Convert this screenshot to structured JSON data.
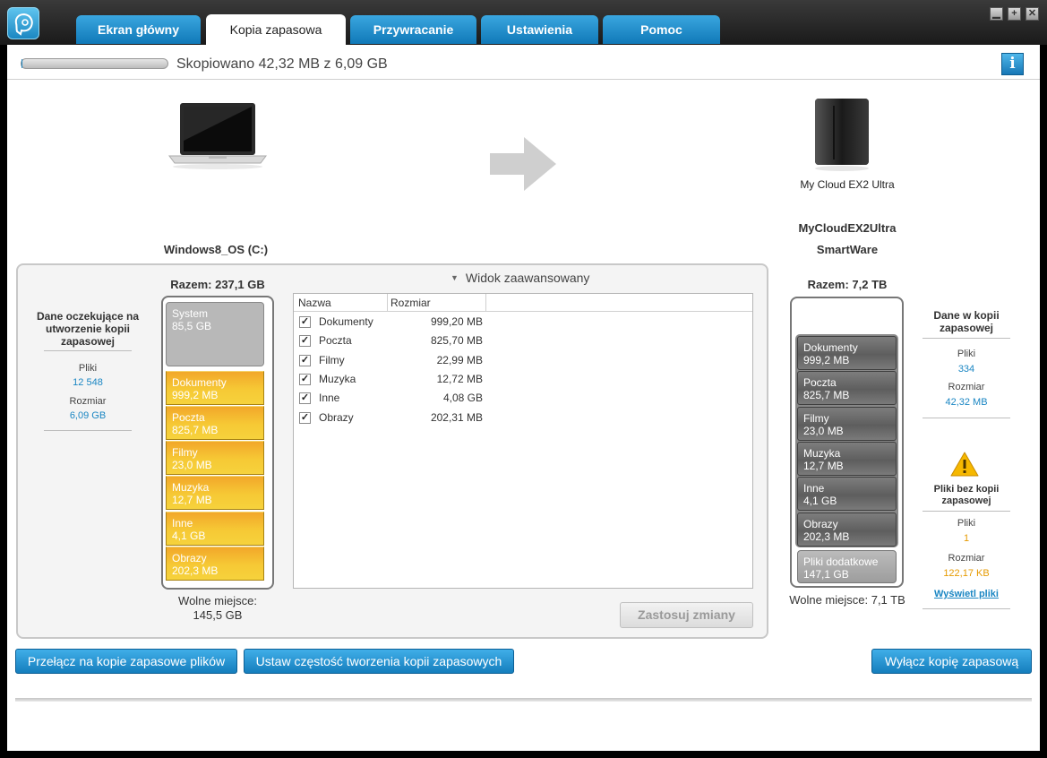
{
  "tabs": [
    {
      "label": "Ekran główny"
    },
    {
      "label": "Kopia zapasowa"
    },
    {
      "label": "Przywracanie"
    },
    {
      "label": "Ustawienia"
    },
    {
      "label": "Pomoc"
    }
  ],
  "window_controls": {
    "minimize": "▁",
    "maximize": "+",
    "close": "✕"
  },
  "progress": {
    "fraction": 0.007,
    "status_text": "Skopiowano 42,32 MB z 6,09 GB"
  },
  "info_button": "i",
  "source": {
    "drive_name": "Windows8_OS (C:)",
    "total": "Razem: 237,1 GB",
    "free": "Wolne miejsce: 145,5 GB",
    "system": {
      "name": "System",
      "size": "85,5 GB"
    },
    "segments": [
      {
        "name": "Dokumenty",
        "size": "999,2 MB"
      },
      {
        "name": "Poczta",
        "size": "825,7 MB"
      },
      {
        "name": "Filmy",
        "size": "23,0 MB"
      },
      {
        "name": "Muzyka",
        "size": "12,7 MB"
      },
      {
        "name": "Inne",
        "size": "4,1 GB"
      },
      {
        "name": "Obrazy",
        "size": "202,3 MB"
      }
    ]
  },
  "pending": {
    "title": "Dane oczekujące na utworzenie kopii zapasowej",
    "files_label": "Pliki",
    "files_value": "12 548",
    "size_label": "Rozmiar",
    "size_value": "6,09 GB"
  },
  "advanced_view": {
    "toggle_label": "Widok zaawansowany",
    "columns": [
      "Nazwa",
      "Rozmiar"
    ],
    "rows": [
      {
        "name": "Dokumenty",
        "size": "999,20 MB",
        "checked": true
      },
      {
        "name": "Poczta",
        "size": "825,70 MB",
        "checked": true
      },
      {
        "name": "Filmy",
        "size": "22,99 MB",
        "checked": true
      },
      {
        "name": "Muzyka",
        "size": "12,72 MB",
        "checked": true
      },
      {
        "name": "Inne",
        "size": "4,08 GB",
        "checked": true
      },
      {
        "name": "Obrazy",
        "size": "202,31 MB",
        "checked": true
      }
    ],
    "apply_button": "Zastosuj zmiany"
  },
  "destination": {
    "device_label": "My Cloud EX2 Ultra",
    "share_name": "MyCloudEX2Ultra",
    "folder_name": "SmartWare",
    "total": "Razem: 7,2 TB",
    "free": "Wolne miejsce: 7,1 TB",
    "segments": [
      {
        "name": "Dokumenty",
        "size": "999,2 MB"
      },
      {
        "name": "Poczta",
        "size": "825,7 MB"
      },
      {
        "name": "Filmy",
        "size": "23,0 MB"
      },
      {
        "name": "Muzyka",
        "size": "12,7 MB"
      },
      {
        "name": "Inne",
        "size": "4,1 GB"
      },
      {
        "name": "Obrazy",
        "size": "202,3 MB"
      }
    ],
    "extra": {
      "name": "Pliki dodatkowe",
      "size": "147,1 GB"
    }
  },
  "backed_up": {
    "title": "Dane w kopii zapasowej",
    "files_label": "Pliki",
    "files_value": "334",
    "size_label": "Rozmiar",
    "size_value": "42,32 MB"
  },
  "not_backed": {
    "title": "Pliki bez kopii zapasowej",
    "files_label": "Pliki",
    "files_value": "1",
    "size_label": "Rozmiar",
    "size_value": "122,17 KB",
    "link": "Wyświetl pliki"
  },
  "bottom_buttons": {
    "switch_files": "Przełącz na kopie zapasowe plików",
    "set_frequency": "Ustaw częstość tworzenia kopii zapasowych",
    "disable_backup": "Wyłącz kopię zapasową"
  },
  "colors": {
    "accent": "#1a86c3",
    "warning": "#e69a00",
    "tab_blue": "#1b87c2"
  }
}
